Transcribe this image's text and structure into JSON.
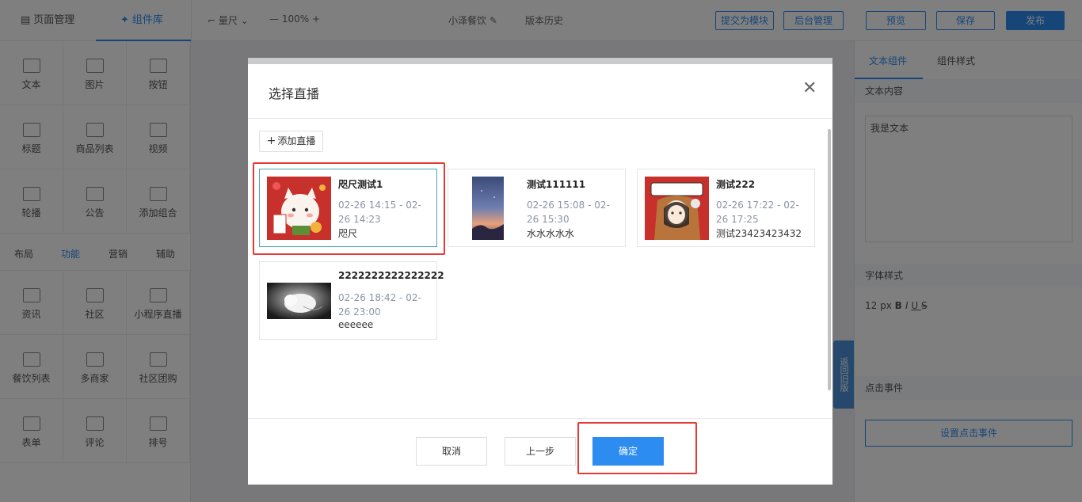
{
  "topbar": {
    "tab_page_manage": "页面管理",
    "tab_components": "组件库",
    "ruler": "量尺",
    "zoom": "100%",
    "app_name": "小泽餐饮",
    "version_history": "版本历史",
    "submit_module": "提交为模块",
    "backend_manage": "后台管理",
    "preview": "预览",
    "save": "保存",
    "publish": "发布"
  },
  "leftpanel": {
    "basic": [
      "文本",
      "图片",
      "按钮",
      "标题",
      "商品列表",
      "视频",
      "轮播",
      "公告",
      "添加组合"
    ],
    "subtabs": [
      "布局",
      "功能",
      "营销",
      "辅助"
    ],
    "functions": [
      "资讯",
      "社区",
      "小程序直播",
      "餐饮列表",
      "多商家",
      "社区团购",
      "表单",
      "评论",
      "排号"
    ]
  },
  "rightpanel": {
    "tab_component": "文本组件",
    "tab_style": "组件样式",
    "text_content_label": "文本内容",
    "text_value": "我是文本",
    "font_style_label": "字体样式",
    "font_size": "12",
    "font_unit": "px",
    "click_event_label": "点击事件",
    "set_click_event": "设置点击事件"
  },
  "float_tab": "返回旧版",
  "modal": {
    "title": "选择直播",
    "add_button": "添加直播",
    "cards": [
      {
        "title": "咫尺测试1",
        "time": "02-26 14:15 - 02-26 14:23",
        "desc": "咫尺"
      },
      {
        "title": "测试111111",
        "time": "02-26 15:08 - 02-26 15:30",
        "desc": "水水水水水"
      },
      {
        "title": "测试222",
        "time": "02-26 17:22 - 02-26 17:25",
        "desc": "测试23423423432"
      },
      {
        "title": "2222222222222222",
        "time": "02-26 18:42 - 02-26 23:00",
        "desc": "eeeeee"
      }
    ],
    "cancel": "取消",
    "prev": "上一步",
    "confirm": "确定"
  },
  "colors": {
    "accent": "#2d8cf0",
    "highlight": "#e53935"
  }
}
